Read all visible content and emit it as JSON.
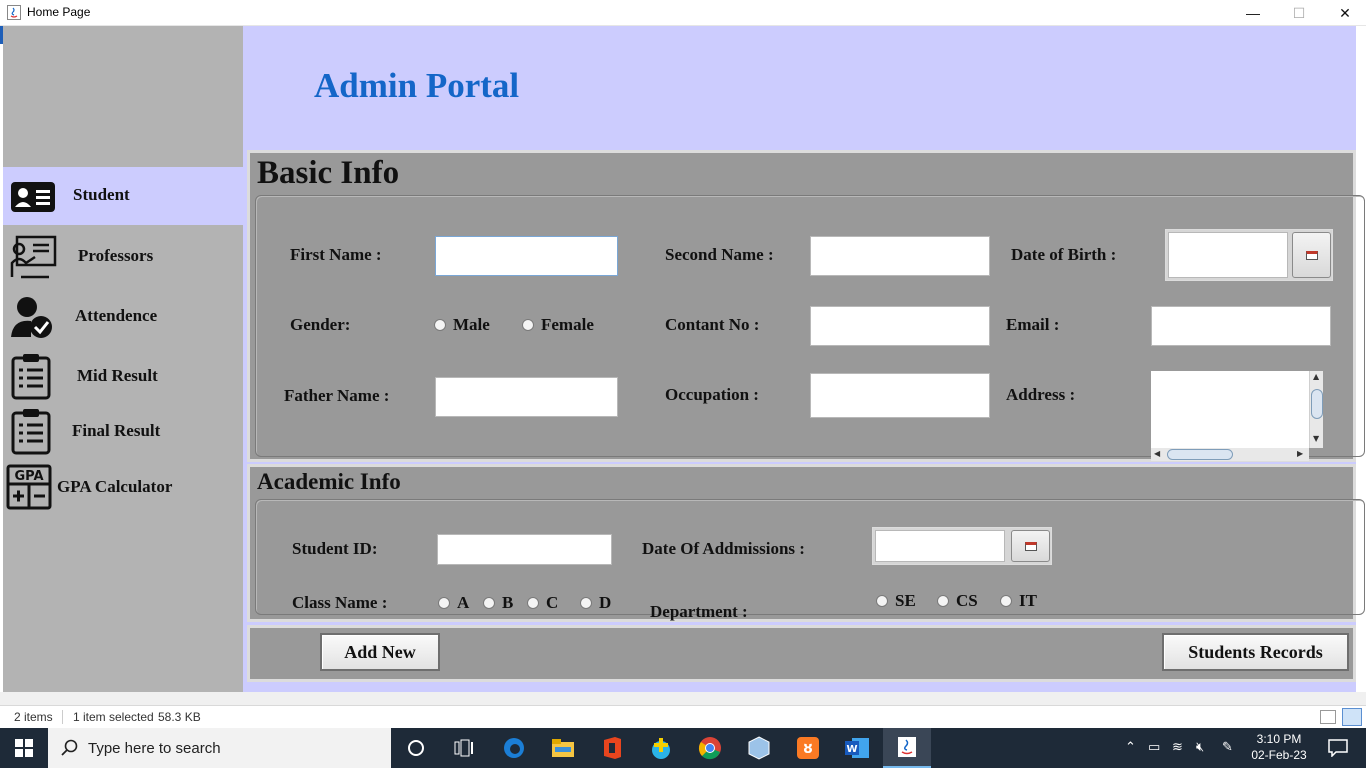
{
  "window": {
    "title": "Home Page",
    "minimize_glyph": "—",
    "maximize_glyph": "☐",
    "close_glyph": "✕"
  },
  "sidebar": {
    "items": [
      {
        "label": "Student",
        "icon": "student-card-icon",
        "active": true
      },
      {
        "label": "Professors",
        "icon": "professor-board-icon",
        "active": false
      },
      {
        "label": "Attendence",
        "icon": "attendance-user-check-icon",
        "active": false
      },
      {
        "label": "Mid Result",
        "icon": "clipboard-icon",
        "active": false
      },
      {
        "label": "Final Result",
        "icon": "clipboard-icon",
        "active": false
      },
      {
        "label": "GPA Calculator",
        "icon": "gpa-calculator-icon",
        "active": false
      }
    ]
  },
  "header": {
    "title": "Admin Portal"
  },
  "basic_info": {
    "title": "Basic Info",
    "first_name_label": "First Name :",
    "first_name_value": "",
    "second_name_label": "Second Name :",
    "second_name_value": "",
    "dob_label": "Date of Birth :",
    "dob_value": "",
    "gender_label": "Gender:",
    "gender_options": [
      "Male",
      "Female"
    ],
    "contact_label": "Contant No :",
    "contact_value": "",
    "email_label": "Email :",
    "email_value": "",
    "father_name_label": "Father Name :",
    "father_name_value": "",
    "occupation_label": "Occupation :",
    "occupation_value": "",
    "address_label": "Address :",
    "address_value": ""
  },
  "academic_info": {
    "title": "Academic Info",
    "student_id_label": "Student ID:",
    "student_id_value": "",
    "admission_label": "Date Of Addmissions :",
    "admission_value": "",
    "class_label": "Class Name :",
    "class_options": [
      "A",
      "B",
      "C",
      "D"
    ],
    "department_label": "Department :",
    "department_options": [
      "SE",
      "CS",
      "IT"
    ]
  },
  "actions": {
    "add_new": "Add New",
    "records": "Students Records"
  },
  "explorer_status": {
    "items": "2 items",
    "selected": "1 item selected",
    "size": "58.3 KB"
  },
  "taskbar": {
    "search_placeholder": "Type here to search",
    "time": "3:10 PM",
    "date": "02-Feb-23",
    "colors": {
      "taskbar": "#1e2a38",
      "accent": "#1466c8"
    }
  }
}
